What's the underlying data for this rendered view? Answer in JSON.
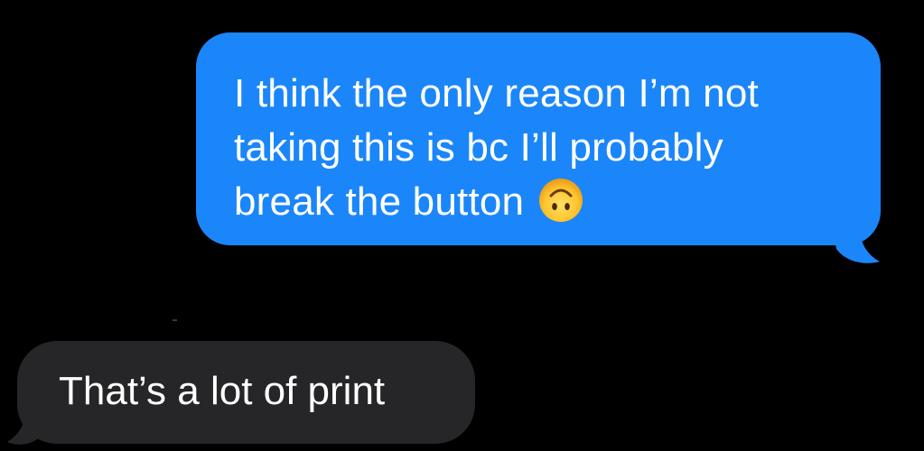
{
  "conversation": {
    "sent_message": {
      "text": "I think the only reason I’m not\ntaking this is bc I’ll probably\nbreak the button",
      "emoji": "upside-down-face",
      "bubble_color": "#1b86f9"
    },
    "received_message": {
      "text": "That’s a lot of print",
      "bubble_color": "#262628"
    }
  }
}
